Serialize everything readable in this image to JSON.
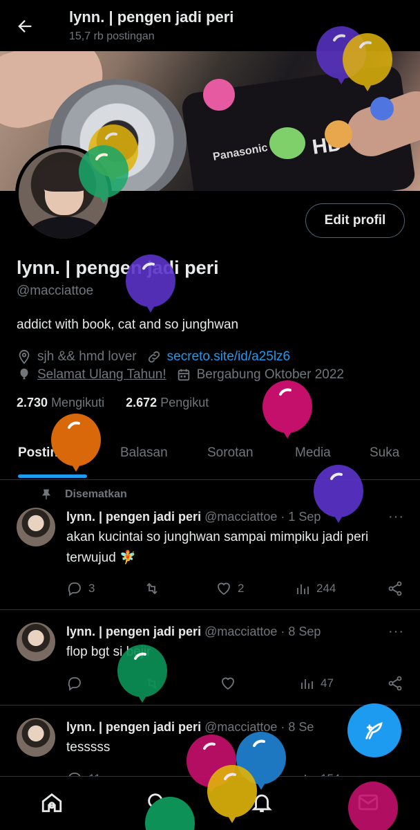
{
  "header": {
    "title": "lynn. | pengen jadi peri",
    "subtitle": "15,7 rb postingan"
  },
  "banner": {
    "brand": "Panasonic",
    "brand2": "HD"
  },
  "profile": {
    "edit_label": "Edit profil",
    "name": "lynn. | pengen jadi peri",
    "handle": "@macciattoe",
    "bio": "addict with book, cat and so junghwan",
    "location": "sjh && hmd lover",
    "website": "secreto.site/id/a25lz6",
    "birthday": "Selamat Ulang Tahun!",
    "joined": "Bergabung Oktober 2022",
    "following_count": "2.730",
    "following_label": "Mengikuti",
    "followers_count": "2.672",
    "followers_label": "Pengikut"
  },
  "tabs": [
    {
      "label": "Postingan"
    },
    {
      "label": "Balasan"
    },
    {
      "label": "Sorotan"
    },
    {
      "label": "Media"
    },
    {
      "label": "Suka"
    }
  ],
  "pinned_label": "Disematkan",
  "posts": [
    {
      "name": "lynn. | pengen jadi peri",
      "meta": "@macciattoe · 1 Sep",
      "text": "akan kucintai so junghwan sampai mimpiku jadi peri terwujud 🧚",
      "replies": "3",
      "retweets": "",
      "likes": "2",
      "views": "244"
    },
    {
      "name": "lynn. | pengen jadi peri",
      "meta": "@macciattoe · 8 Sep",
      "text": "flop bgt si bejir",
      "replies": "",
      "retweets": "",
      "likes": "",
      "views": "47"
    },
    {
      "name": "lynn. | pengen jadi peri",
      "meta": "@macciattoe · 8 Se",
      "text": "tesssss",
      "replies": "11",
      "retweets": "",
      "likes": "",
      "views": "154"
    }
  ],
  "more_glyph": "···",
  "icons": {
    "back": "arrow-left-icon",
    "location": "location-pin-icon",
    "link": "link-icon",
    "birthday": "balloon-icon",
    "calendar": "calendar-icon",
    "pin": "pin-icon",
    "reply": "reply-icon",
    "retweet": "retweet-icon",
    "like": "heart-icon",
    "views": "views-icon",
    "share": "share-icon",
    "compose": "compose-feather-icon",
    "home": "home-icon",
    "search": "search-icon",
    "notifications": "bell-icon",
    "messages": "mail-icon"
  },
  "colors": {
    "accent": "#1d9bf0",
    "background": "#000000",
    "muted": "#71767b",
    "text": "#e7e9ea",
    "balloons": [
      "#5b34c9",
      "#e0b40c",
      "#1aa86a",
      "#c4106b",
      "#d9680a",
      "#1d78c1",
      "#0d9156"
    ]
  }
}
